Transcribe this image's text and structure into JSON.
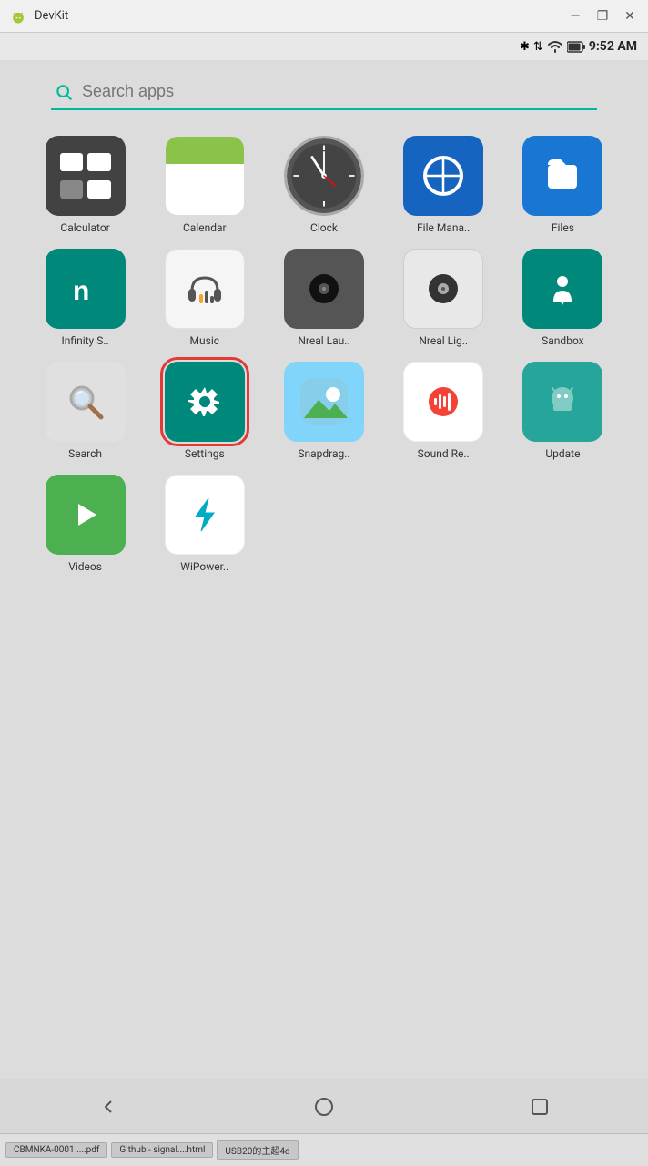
{
  "titlebar": {
    "title": "DevKit",
    "minimize": "—",
    "restore": "❐",
    "close": "✕"
  },
  "statusbar": {
    "time": "9:52 AM",
    "bluetooth": "✱",
    "signal": "⬆",
    "wifi": "▾",
    "battery": "🔋"
  },
  "search": {
    "placeholder": "Search apps"
  },
  "apps": [
    {
      "id": "calculator",
      "label": "Calculator",
      "icon": "calculator"
    },
    {
      "id": "calendar",
      "label": "Calendar",
      "icon": "calendar"
    },
    {
      "id": "clock",
      "label": "Clock",
      "icon": "clock"
    },
    {
      "id": "filemanager",
      "label": "File Mana..",
      "icon": "filemanager"
    },
    {
      "id": "files",
      "label": "Files",
      "icon": "files"
    },
    {
      "id": "infinity",
      "label": "Infinity S..",
      "icon": "infinity"
    },
    {
      "id": "music",
      "label": "Music",
      "icon": "music"
    },
    {
      "id": "nreallauncher",
      "label": "Nreal Lau..",
      "icon": "nreal-launcher"
    },
    {
      "id": "nreallight",
      "label": "Nreal Lig..",
      "icon": "nreal-light"
    },
    {
      "id": "sandbox",
      "label": "Sandbox",
      "icon": "sandbox"
    },
    {
      "id": "search",
      "label": "Search",
      "icon": "search"
    },
    {
      "id": "settings",
      "label": "Settings",
      "icon": "settings",
      "selected": true
    },
    {
      "id": "snapdragon",
      "label": "Snapdrag..",
      "icon": "snapdragon"
    },
    {
      "id": "soundrecorder",
      "label": "Sound Re..",
      "icon": "soundrecorder"
    },
    {
      "id": "update",
      "label": "Update",
      "icon": "update"
    },
    {
      "id": "videos",
      "label": "Videos",
      "icon": "videos"
    },
    {
      "id": "wipower",
      "label": "WiPower..",
      "icon": "wipower"
    }
  ],
  "navbar": {
    "back": "◁",
    "home": "○",
    "recent": "□"
  },
  "taskbar": {
    "items": [
      "CBMNKA-0001 ....pdf",
      "Github - signal....html",
      "USB20的主超4d"
    ]
  }
}
